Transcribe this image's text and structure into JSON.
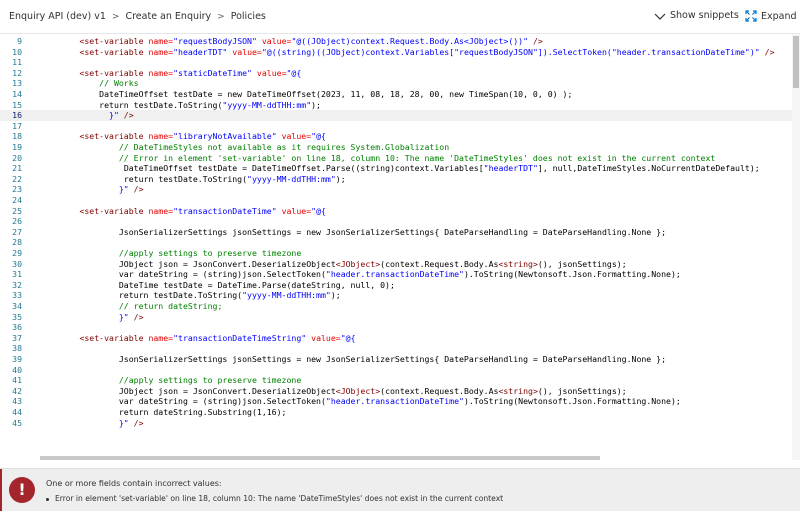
{
  "breadcrumb": {
    "items": [
      "Enquiry API (dev) v1",
      "Create an Enquiry",
      "Policies"
    ],
    "separator": ">"
  },
  "toolbar": {
    "show_snippets_label": "Show snippets",
    "expand_label": "Expand"
  },
  "editor": {
    "language": "xml-policy",
    "current_line": 16,
    "lines": [
      {
        "n": 9,
        "tokens": [
          [
            "sp",
            "        "
          ],
          [
            "tag",
            "<set-variable "
          ],
          [
            "attr",
            "name="
          ],
          [
            "str",
            "\"requestBodyJSON\""
          ],
          [
            "txt",
            " "
          ],
          [
            "attr",
            "value="
          ],
          [
            "str",
            "\"@((JObject)context.Request.Body.As<JObject>())\""
          ],
          [
            "tag",
            " />"
          ]
        ]
      },
      {
        "n": 10,
        "tokens": [
          [
            "sp",
            "        "
          ],
          [
            "tag",
            "<set-variable "
          ],
          [
            "attr",
            "name="
          ],
          [
            "str",
            "\"headerTDT\""
          ],
          [
            "txt",
            " "
          ],
          [
            "attr",
            "value="
          ],
          [
            "str",
            "\"@((string)((JObject)context.Variables[\"requestBodyJSON\"]).SelectToken(\"header.transactionDateTime\")\""
          ],
          [
            "tag",
            " />"
          ]
        ]
      },
      {
        "n": 11,
        "tokens": []
      },
      {
        "n": 12,
        "tokens": [
          [
            "sp",
            "        "
          ],
          [
            "tag",
            "<set-variable "
          ],
          [
            "attr",
            "name="
          ],
          [
            "str",
            "\"staticDateTime\""
          ],
          [
            "txt",
            " "
          ],
          [
            "attr",
            "value="
          ],
          [
            "str",
            "\"@{"
          ]
        ]
      },
      {
        "n": 13,
        "tokens": [
          [
            "sp",
            "            "
          ],
          [
            "com",
            "// Works"
          ]
        ]
      },
      {
        "n": 14,
        "tokens": [
          [
            "sp",
            "            "
          ],
          [
            "txt",
            "DateTimeOffset testDate = new DateTimeOffset(2023, 11, 08, 18, 28, 00, new TimeSpan(10, 0, 0) );"
          ]
        ]
      },
      {
        "n": 15,
        "tokens": [
          [
            "sp",
            "            "
          ],
          [
            "txt",
            "return testDate.ToString("
          ],
          [
            "str",
            "\"yyyy-MM-ddTHH:mm\""
          ],
          [
            "txt",
            ");"
          ]
        ]
      },
      {
        "n": 16,
        "tokens": [
          [
            "sp",
            "              "
          ],
          [
            "str",
            "}\""
          ],
          [
            "tag",
            " />"
          ]
        ]
      },
      {
        "n": 17,
        "tokens": []
      },
      {
        "n": 18,
        "tokens": [
          [
            "sp",
            "        "
          ],
          [
            "tag",
            "<set-variable "
          ],
          [
            "attr",
            "name="
          ],
          [
            "str",
            "\"libraryNotAvailable\""
          ],
          [
            "txt",
            " "
          ],
          [
            "attr",
            "value="
          ],
          [
            "str",
            "\"@{"
          ]
        ]
      },
      {
        "n": 19,
        "tokens": [
          [
            "sp",
            "                "
          ],
          [
            "com",
            "// DateTimeStyles not available as it requires System.Globalization"
          ]
        ]
      },
      {
        "n": 20,
        "tokens": [
          [
            "sp",
            "                "
          ],
          [
            "com",
            "// Error in element 'set-variable' on line 18, column 10: The name 'DateTimeStyles' does not exist in the current context"
          ]
        ]
      },
      {
        "n": 21,
        "tokens": [
          [
            "sp",
            "                 "
          ],
          [
            "txt",
            "DateTimeOffset testDate = DateTimeOffset.Parse((string)context.Variables["
          ],
          [
            "str",
            "\"headerTDT\""
          ],
          [
            "txt",
            "], null,DateTimeStyles.NoCurrentDateDefault);"
          ]
        ]
      },
      {
        "n": 22,
        "tokens": [
          [
            "sp",
            "                 "
          ],
          [
            "txt",
            "return testDate.ToString("
          ],
          [
            "str",
            "\"yyyy-MM-ddTHH:mm\""
          ],
          [
            "txt",
            ");"
          ]
        ]
      },
      {
        "n": 23,
        "tokens": [
          [
            "sp",
            "                "
          ],
          [
            "str",
            "}\""
          ],
          [
            "tag",
            " />"
          ]
        ]
      },
      {
        "n": 24,
        "tokens": []
      },
      {
        "n": 25,
        "tokens": [
          [
            "sp",
            "        "
          ],
          [
            "tag",
            "<set-variable "
          ],
          [
            "attr",
            "name="
          ],
          [
            "str",
            "\"transactionDateTime\""
          ],
          [
            "txt",
            " "
          ],
          [
            "attr",
            "value="
          ],
          [
            "str",
            "\"@{"
          ]
        ]
      },
      {
        "n": 26,
        "tokens": []
      },
      {
        "n": 27,
        "tokens": [
          [
            "sp",
            "                "
          ],
          [
            "txt",
            "JsonSerializerSettings jsonSettings = new JsonSerializerSettings{ DateParseHandling = DateParseHandling.None };"
          ]
        ]
      },
      {
        "n": 28,
        "tokens": []
      },
      {
        "n": 29,
        "tokens": [
          [
            "sp",
            "                "
          ],
          [
            "com",
            "//apply settings to preserve timezone"
          ]
        ]
      },
      {
        "n": 30,
        "tokens": [
          [
            "sp",
            "                "
          ],
          [
            "txt",
            "JObject json = JsonConvert.DeserializeObject"
          ],
          [
            "tag",
            "<JObject>"
          ],
          [
            "txt",
            "(context.Request.Body.As"
          ],
          [
            "tag",
            "<string>"
          ],
          [
            "txt",
            "(), jsonSettings);"
          ]
        ]
      },
      {
        "n": 31,
        "tokens": [
          [
            "sp",
            "                "
          ],
          [
            "txt",
            "var dateString = (string)json.SelectToken("
          ],
          [
            "str",
            "\"header.transactionDateTime\""
          ],
          [
            "txt",
            ").ToString(Newtonsoft.Json.Formatting.None);"
          ]
        ]
      },
      {
        "n": 32,
        "tokens": [
          [
            "sp",
            "                "
          ],
          [
            "txt",
            "DateTime testDate = DateTime.Parse(dateString, null, 0);"
          ]
        ]
      },
      {
        "n": 33,
        "tokens": [
          [
            "sp",
            "                "
          ],
          [
            "txt",
            "return testDate.ToString("
          ],
          [
            "str",
            "\"yyyy-MM-ddTHH:mm\""
          ],
          [
            "txt",
            ");"
          ]
        ]
      },
      {
        "n": 34,
        "tokens": [
          [
            "sp",
            "                "
          ],
          [
            "com",
            "// return dateString;"
          ]
        ]
      },
      {
        "n": 35,
        "tokens": [
          [
            "sp",
            "                "
          ],
          [
            "str",
            "}\""
          ],
          [
            "tag",
            " />"
          ]
        ]
      },
      {
        "n": 36,
        "tokens": []
      },
      {
        "n": 37,
        "tokens": [
          [
            "sp",
            "        "
          ],
          [
            "tag",
            "<set-variable "
          ],
          [
            "attr",
            "name="
          ],
          [
            "str",
            "\"transactionDateTimeString\""
          ],
          [
            "txt",
            " "
          ],
          [
            "attr",
            "value="
          ],
          [
            "str",
            "\"@{"
          ]
        ]
      },
      {
        "n": 38,
        "tokens": []
      },
      {
        "n": 39,
        "tokens": [
          [
            "sp",
            "                "
          ],
          [
            "txt",
            "JsonSerializerSettings jsonSettings = new JsonSerializerSettings{ DateParseHandling = DateParseHandling.None };"
          ]
        ]
      },
      {
        "n": 40,
        "tokens": []
      },
      {
        "n": 41,
        "tokens": [
          [
            "sp",
            "                "
          ],
          [
            "com",
            "//apply settings to preserve timezone"
          ]
        ]
      },
      {
        "n": 42,
        "tokens": [
          [
            "sp",
            "                "
          ],
          [
            "txt",
            "JObject json = JsonConvert.DeserializeObject"
          ],
          [
            "tag",
            "<JObject>"
          ],
          [
            "txt",
            "(context.Request.Body.As"
          ],
          [
            "tag",
            "<string>"
          ],
          [
            "txt",
            "(), jsonSettings);"
          ]
        ]
      },
      {
        "n": 43,
        "tokens": [
          [
            "sp",
            "                "
          ],
          [
            "txt",
            "var dateString = (string)json.SelectToken("
          ],
          [
            "str",
            "\"header.transactionDateTime\""
          ],
          [
            "txt",
            ").ToString(Newtonsoft.Json.Formatting.None);"
          ]
        ]
      },
      {
        "n": 44,
        "tokens": [
          [
            "sp",
            "                "
          ],
          [
            "txt",
            "return dateString.Substring(1,16);"
          ]
        ]
      },
      {
        "n": 45,
        "tokens": [
          [
            "sp",
            "                "
          ],
          [
            "str",
            "}\""
          ],
          [
            "tag",
            " />"
          ]
        ]
      }
    ]
  },
  "error_panel": {
    "icon_glyph": "!",
    "title": "One or more fields contain incorrect values:",
    "items": [
      "Error in element 'set-variable' on line 18, column 10: The name 'DateTimeStyles' does not exist in the current context"
    ]
  },
  "colors": {
    "line_number": "#237893",
    "xml_tag": "#800000",
    "xml_attr": "#e50000",
    "string": "#0000ff",
    "comment": "#008000",
    "error": "#a4262c"
  }
}
